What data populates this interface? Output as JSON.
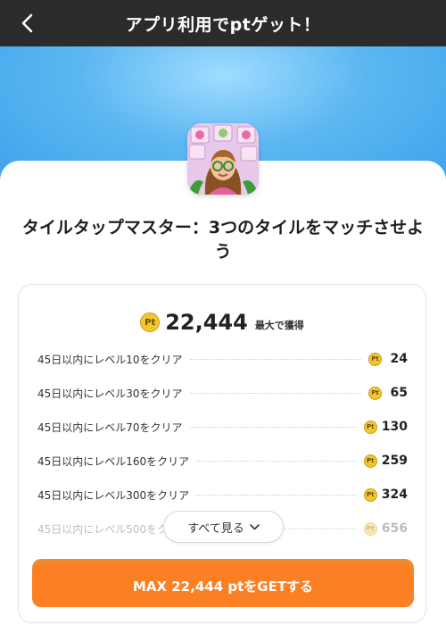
{
  "header": {
    "title": "アプリ利用でptゲット！"
  },
  "app": {
    "title": "タイルタップマスター：3つのタイルをマッチさせよう"
  },
  "summary": {
    "coin_label": "Pt",
    "amount": "22,444",
    "suffix": "最大で獲得"
  },
  "tasks": [
    {
      "label": "45日以内にレベル10をクリア",
      "points": "24"
    },
    {
      "label": "45日以内にレベル30をクリア",
      "points": "65"
    },
    {
      "label": "45日以内にレベル70をクリア",
      "points": "130"
    },
    {
      "label": "45日以内にレベル160をクリア",
      "points": "259"
    },
    {
      "label": "45日以内にレベル300をクリア",
      "points": "324"
    },
    {
      "label": "45日以内にレベル500をク",
      "points": "656"
    }
  ],
  "see_all": {
    "label": "すべて見る"
  },
  "cta": {
    "label": "MAX 22,444 ptをGETする"
  },
  "colors": {
    "accent": "#fb7f23",
    "coin": "#f2c72e",
    "hero": "#5cb7f1",
    "header": "#2b2b2b"
  }
}
